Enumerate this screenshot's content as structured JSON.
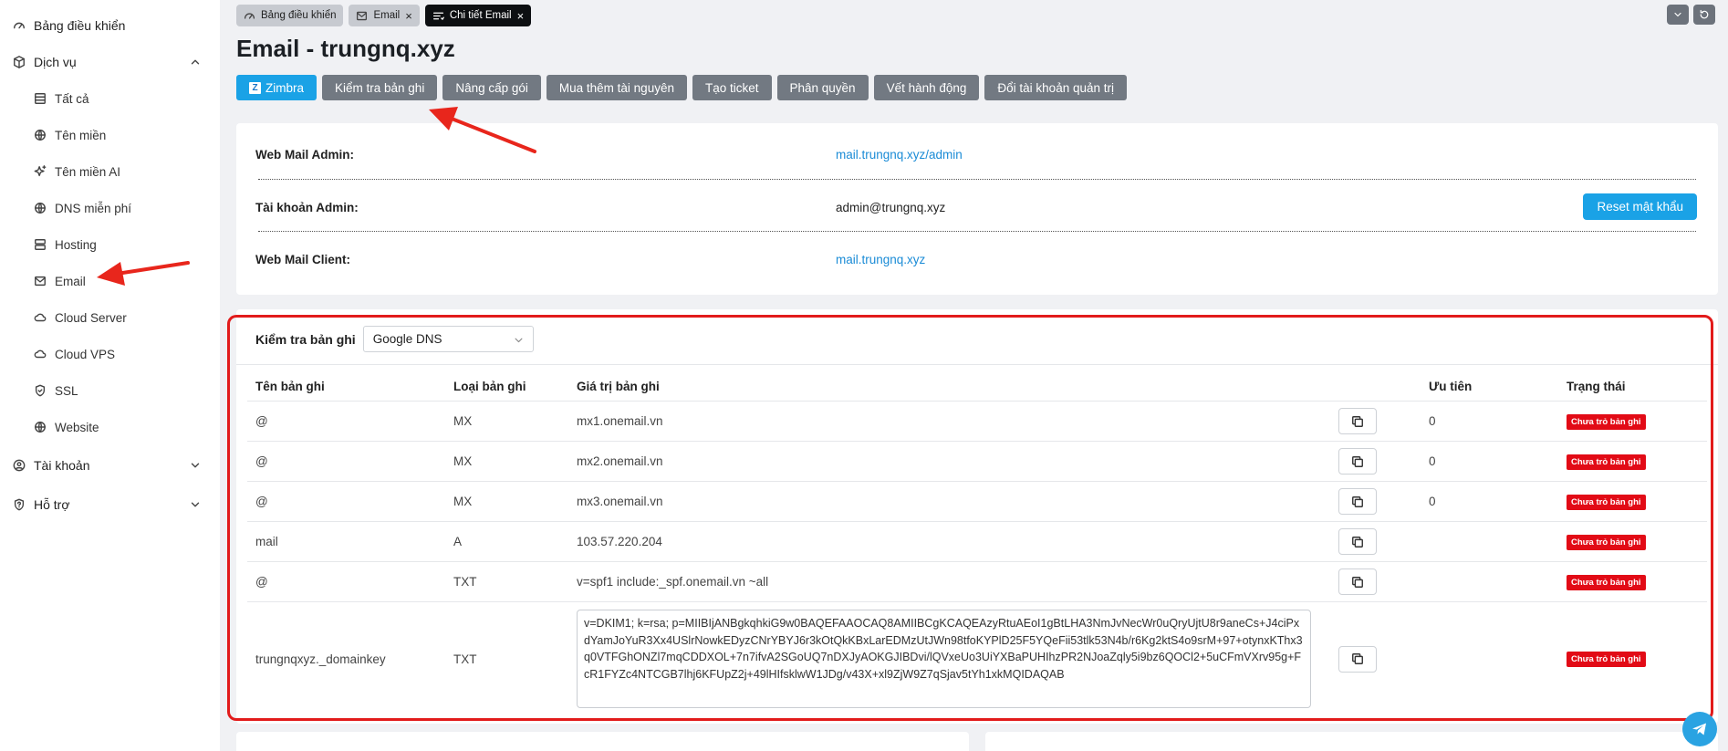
{
  "sidebar": {
    "items": [
      {
        "label": "Bảng điều khiển",
        "icon": "gauge-icon"
      },
      {
        "label": "Dịch vụ",
        "icon": "box-icon",
        "expanded": true
      }
    ],
    "sub_items": [
      {
        "label": "Tất cả",
        "icon": "list-icon"
      },
      {
        "label": "Tên miền",
        "icon": "globe-icon"
      },
      {
        "label": "Tên miền AI",
        "icon": "sparkle-icon"
      },
      {
        "label": "DNS miễn phí",
        "icon": "globe-icon"
      },
      {
        "label": "Hosting",
        "icon": "server-icon"
      },
      {
        "label": "Email",
        "icon": "mail-icon"
      },
      {
        "label": "Cloud Server",
        "icon": "cloud-icon"
      },
      {
        "label": "Cloud VPS",
        "icon": "cloud-icon"
      },
      {
        "label": "SSL",
        "icon": "shield-icon"
      },
      {
        "label": "Website",
        "icon": "globe-icon"
      }
    ],
    "bottom_items": [
      {
        "label": "Tài khoản",
        "icon": "user-icon"
      },
      {
        "label": "Hỗ trợ",
        "icon": "help-icon"
      }
    ]
  },
  "tabs": [
    {
      "label": "Bảng điều khiển",
      "icon": "gauge-icon"
    },
    {
      "label": "Email",
      "icon": "mail-icon"
    },
    {
      "label": "Chi tiết Email",
      "icon": "detail-icon",
      "active": true
    }
  ],
  "page_title": "Email - trungnq.xyz",
  "actions": [
    {
      "label": "Zimbra",
      "primary": true
    },
    {
      "label": "Kiểm tra bản ghi"
    },
    {
      "label": "Nâng cấp gói"
    },
    {
      "label": "Mua thêm tài nguyên"
    },
    {
      "label": "Tạo ticket"
    },
    {
      "label": "Phân quyền"
    },
    {
      "label": "Vết hành động"
    },
    {
      "label": "Đổi tài khoản quản trị"
    }
  ],
  "zimbra_logo": "Z",
  "info": {
    "webmail_admin_label": "Web Mail Admin:",
    "webmail_admin_value": "mail.trungnq.xyz/admin",
    "admin_account_label": "Tài khoản Admin:",
    "admin_account_value": "admin@trungnq.xyz",
    "reset_password_label": "Reset mật khẩu",
    "webmail_client_label": "Web Mail Client:",
    "webmail_client_value": "mail.trungnq.xyz"
  },
  "records": {
    "check_label": "Kiểm tra bản ghi",
    "dns_selected": "Google DNS",
    "columns": [
      "Tên bản ghi",
      "Loại bản ghi",
      "Giá trị bản ghi",
      "",
      "Ưu tiên",
      "Trạng thái"
    ],
    "rows": [
      {
        "name": "@",
        "type": "MX",
        "value": "mx1.onemail.vn",
        "priority": "0",
        "status": "Chưa trỏ bản ghi"
      },
      {
        "name": "@",
        "type": "MX",
        "value": "mx2.onemail.vn",
        "priority": "0",
        "status": "Chưa trỏ bản ghi"
      },
      {
        "name": "@",
        "type": "MX",
        "value": "mx3.onemail.vn",
        "priority": "0",
        "status": "Chưa trỏ bản ghi"
      },
      {
        "name": "mail",
        "type": "A",
        "value": "103.57.220.204",
        "priority": "",
        "status": "Chưa trỏ bản ghi"
      },
      {
        "name": "@",
        "type": "TXT",
        "value": "v=spf1 include:_spf.onemail.vn ~all",
        "priority": "",
        "status": "Chưa trỏ bản ghi"
      }
    ],
    "dkim": {
      "name": "trungnqxyz._domainkey",
      "type": "TXT",
      "value": "v=DKIM1; k=rsa; p=MIIBIjANBgkqhkiG9w0BAQEFAAOCAQ8AMIIBCgKCAQEAzyRtuAEoI1gBtLHA3NmJvNecWr0uQryUjtU8r9aneCs+J4ciPxdYamJoYuR3Xx4USlrNowkEDyzCNrYBYJ6r3kOtQkKBxLarEDMzUtJWn98tfoKYPlD25F5YQeFii53tlk53N4b/r6Kg2ktS4o9srM+97+otynxKThx3q0VTFGhONZl7mqCDDXOL+7n7ifvA2SGoUQ7nDXJyAOKGJIBDvi/lQVxeUo3UiYXBaPUHIhzPR2NJoaZqly5i9bz6QOCl2+5uCFmVXrv95g+FcR1FYZc4NTCGB7lhj6KFUpZ2j+49lHIfsklwW1JDg/v43X+xl9ZjW9Z7qSjav5tYh1xkMQIDAQAB",
      "priority": "",
      "status": "Chưa trỏ bản ghi"
    }
  }
}
